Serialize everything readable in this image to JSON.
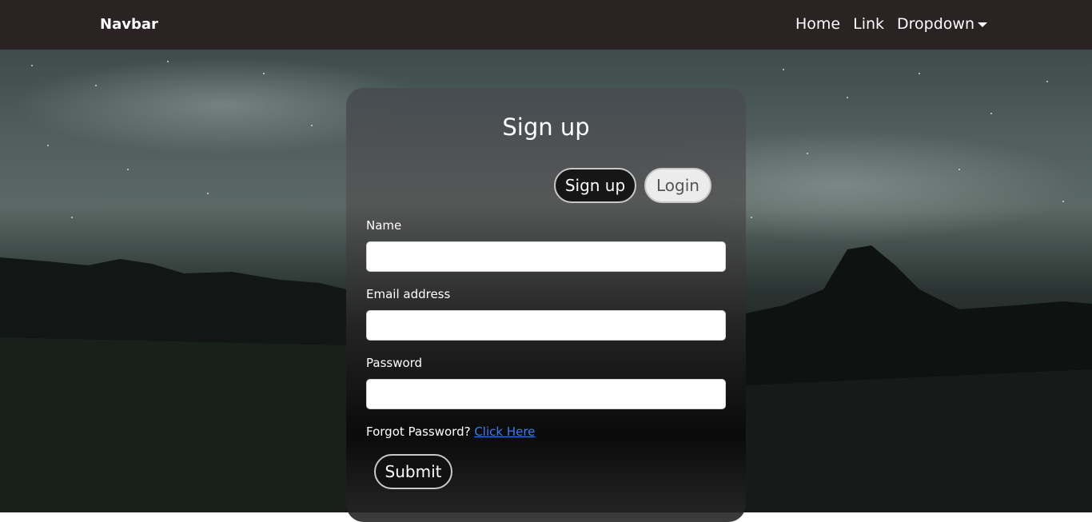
{
  "navbar": {
    "brand": "Navbar",
    "links": {
      "home": "Home",
      "link": "Link",
      "dropdown": "Dropdown"
    }
  },
  "form": {
    "title": "Sign up",
    "tab_signup": "Sign up",
    "tab_login": "Login",
    "name_label": "Name",
    "name_value": "",
    "email_label": "Email address",
    "email_value": "",
    "password_label": "Password",
    "password_value": "",
    "forgot_text": "Forgot Password?",
    "forgot_link": "Click Here",
    "submit": "Submit"
  },
  "colors": {
    "navbar_bg": "#2a2223",
    "link_blue": "#3d7cf5",
    "active_pill": "#161616",
    "inactive_pill": "#ececec"
  }
}
